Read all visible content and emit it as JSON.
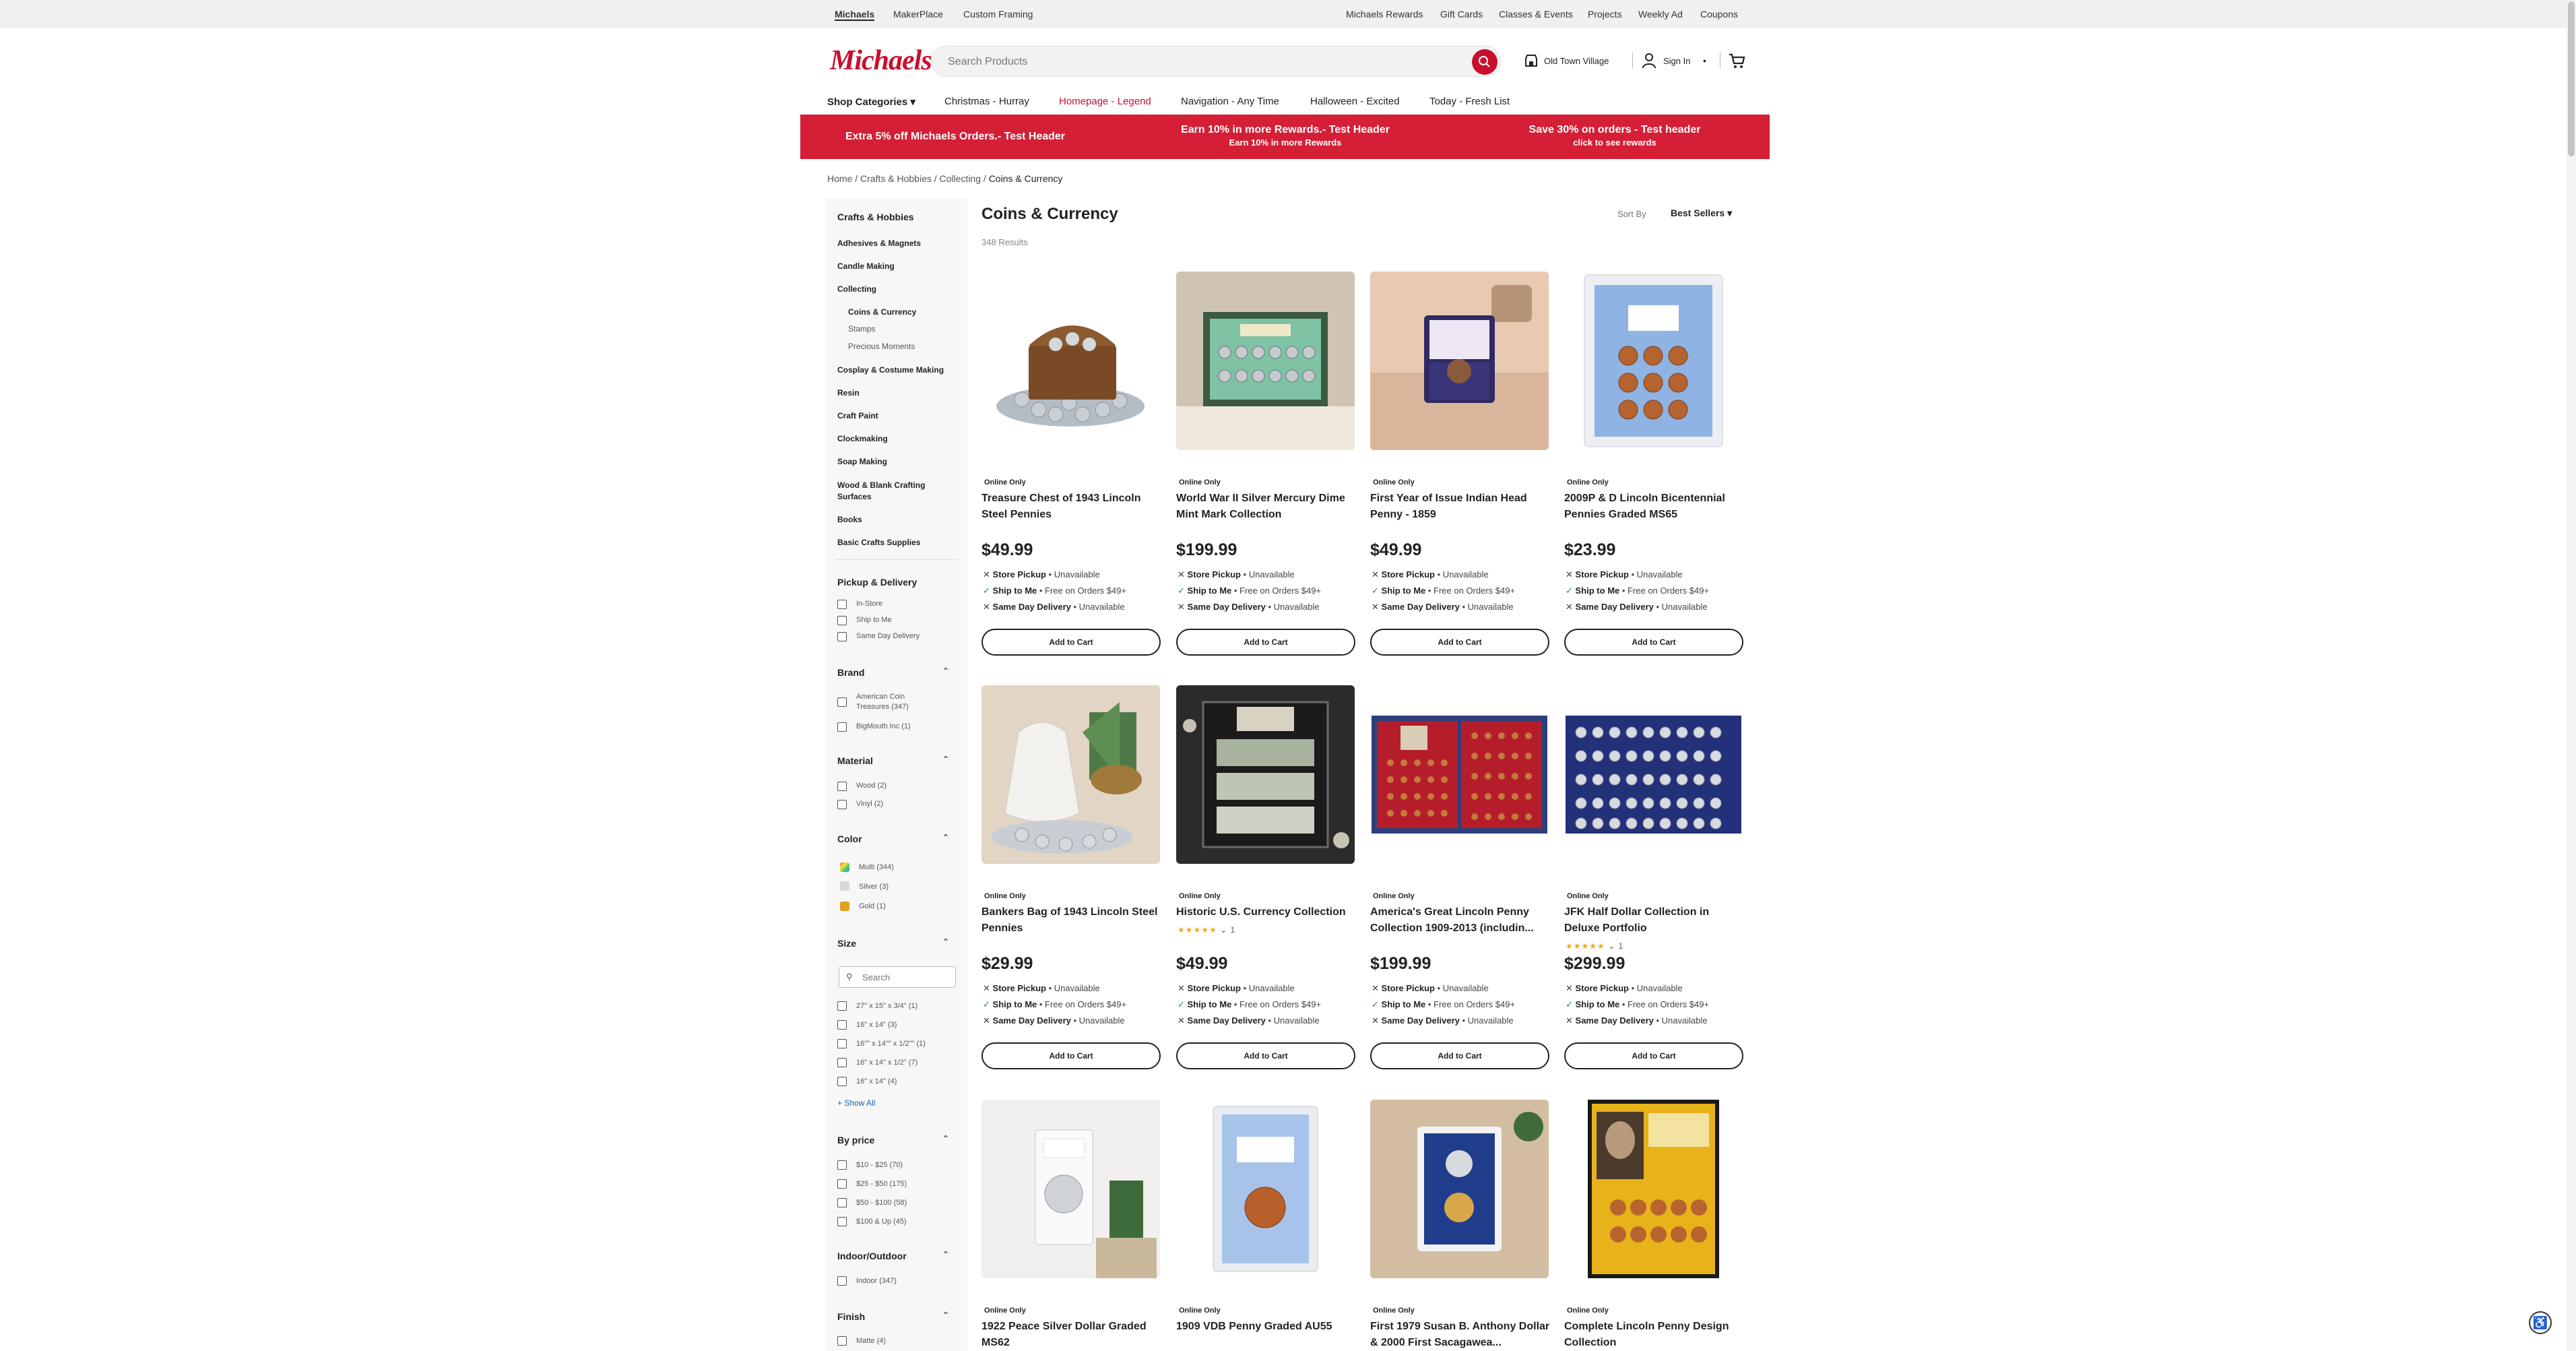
{
  "topbar": {
    "left": [
      "Michaels",
      "MakerPlace",
      "Custom Framing"
    ],
    "right": [
      "Michaels Rewards",
      "Gift Cards",
      "Classes & Events",
      "Projects",
      "Weekly Ad",
      "Coupons"
    ]
  },
  "header": {
    "logo": "Michaels",
    "search_placeholder": "Search Products",
    "store": "Old Town Village",
    "sign_in": "Sign In"
  },
  "nav": {
    "shop": "Shop Categories",
    "items": [
      "Christmas - Hurray",
      "Homepage - Legend",
      "Navigation - Any Time",
      "Halloween - Excited",
      "Today - Fresh List"
    ]
  },
  "banner": [
    {
      "title": "Extra 5% off Michaels Orders.- Test Header",
      "sub": ""
    },
    {
      "title": "Earn 10% in more Rewards.- Test Header",
      "sub": "Earn 10% in more Rewards"
    },
    {
      "title": "Save 30% on orders - Test header",
      "sub": "click to see rewards"
    }
  ],
  "breadcrumb": [
    "Home",
    "Crafts & Hobbies",
    "Collecting",
    "Coins & Currency"
  ],
  "sidebar": {
    "title": "Crafts & Hobbies",
    "cats": [
      "Adhesives & Magnets",
      "Candle Making",
      "Collecting"
    ],
    "subs": [
      "Coins & Currency",
      "Stamps",
      "Precious Moments"
    ],
    "cats2": [
      "Cosplay & Costume Making",
      "Resin",
      "Craft Paint",
      "Clockmaking",
      "Soap Making",
      "Wood & Blank Crafting Surfaces",
      "Books",
      "Basic Crafts Supplies"
    ]
  },
  "filters": {
    "pickup": {
      "title": "Pickup & Delivery",
      "opts": [
        "In-Store",
        "Ship to Me",
        "Same Day Delivery"
      ]
    },
    "brand": {
      "title": "Brand",
      "opts": [
        "American Coin Treasures (347)",
        "BigMouth Inc (1)"
      ]
    },
    "material": {
      "title": "Material",
      "opts": [
        "Wood (2)",
        "Vinyl (2)"
      ]
    },
    "color": {
      "title": "Color",
      "opts": [
        "Multi (344)",
        "Silver (3)",
        "Gold (1)"
      ]
    },
    "size": {
      "title": "Size",
      "search": "Search",
      "opts": [
        "27\" x 15\" x 3/4\" (1)",
        "16\" x 14\" (3)",
        "16\"\" x 14\"\" x 1/2\"\" (1)",
        "16\" x 14\" x 1/2\" (7)",
        "16\" x 14\" (4)"
      ],
      "show_all": "Show All"
    },
    "price": {
      "title": "By price",
      "opts": [
        "$10 - $25 (70)",
        "$25 - $50 (175)",
        "$50 - $100 (58)",
        "$100 & Up (45)"
      ]
    },
    "indoor": {
      "title": "Indoor/Outdoor",
      "opts": [
        "Indoor (347)"
      ]
    },
    "finish": {
      "title": "Finish",
      "opts": [
        "Matte (4)"
      ]
    }
  },
  "main": {
    "title": "Coins & Currency",
    "results": "348 Results",
    "sort_label": "Sort By",
    "sort_value": "Best Sellers"
  },
  "labels": {
    "online": "Online Only",
    "pickup": "Store Pickup",
    "ship": "Ship to Me",
    "sameday": "Same Day Delivery",
    "unavailable": "Unavailable",
    "free": "Free on Orders $49+",
    "add": "Add to Cart"
  },
  "products": [
    {
      "name": "Treasure Chest of 1943 Lincoln Steel Pennies",
      "price": "$49.99"
    },
    {
      "name": "World War II Silver Mercury Dime Mint Mark Collection",
      "price": "$199.99"
    },
    {
      "name": "First Year of Issue Indian Head Penny - 1859",
      "price": "$49.99"
    },
    {
      "name": "2009P & D Lincoln Bicentennial Pennies Graded MS65",
      "price": "$23.99"
    },
    {
      "name": "Bankers Bag of 1943 Lincoln Steel Pennies",
      "price": "$29.99"
    },
    {
      "name": "Historic U.S. Currency Collection",
      "price": "$49.99",
      "reviews": "1"
    },
    {
      "name": "America's Great Lincoln Penny Collection 1909-2013 (includin...",
      "price": "$199.99"
    },
    {
      "name": "JFK Half Dollar Collection in Deluxe Portfolio",
      "price": "$299.99",
      "reviews": "1"
    },
    {
      "name": "1922 Peace Silver Dollar Graded MS62",
      "price": ""
    },
    {
      "name": "1909 VDB Penny Graded AU55",
      "price": ""
    },
    {
      "name": "First 1979 Susan B. Anthony Dollar & 2000 First Sacagawea...",
      "price": ""
    },
    {
      "name": "Complete Lincoln Penny Design Collection",
      "price": ""
    }
  ],
  "colors": {
    "brand": "#c8102e",
    "banner": "#d41f36",
    "green": "#2e8b3c"
  }
}
